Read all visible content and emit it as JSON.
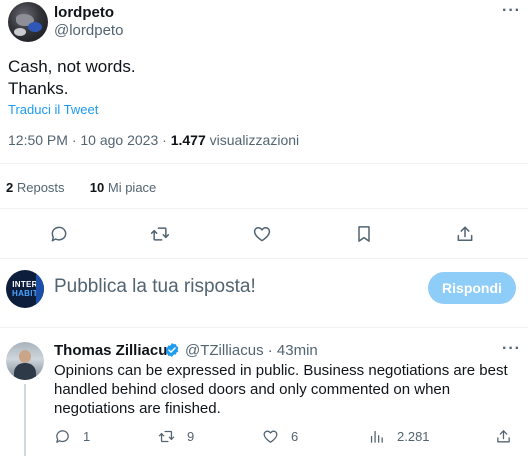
{
  "tweet": {
    "display_name": "lordpeto",
    "handle": "@lordpeto",
    "more": "···",
    "text_line1": "Cash, not words.",
    "text_line2": "Thanks.",
    "translate": "Traduci il Tweet",
    "time": "12:50 PM",
    "sep": " · ",
    "date": "10 ago 2023",
    "views_count": "1.477",
    "views_label": " visualizzazioni",
    "reposts_count": "2",
    "reposts_label": " Reposts",
    "likes_count": "10",
    "likes_label": " Mi piace"
  },
  "composer": {
    "avatar_line1": "INTER",
    "avatar_line2": "HABIT",
    "placeholder": "Pubblica la tua risposta!",
    "reply_button": "Rispondi"
  },
  "reply": {
    "display_name": "Thomas Zilliacus",
    "handle": "@TZilliacus · 43min",
    "more": "···",
    "text": "Opinions can be expressed in public. Business negotiations are best handled behind closed doors and only commented on when negotiations are finished.",
    "replies": "1",
    "reposts": "9",
    "likes": "6",
    "views": "2.281"
  },
  "colors": {
    "accent": "#1d9bf0",
    "reply_button_bg": "#8ecdf8",
    "muted": "#536471"
  },
  "icons": [
    "reply-icon",
    "repost-icon",
    "like-icon",
    "bookmark-icon",
    "share-icon",
    "verified-icon",
    "views-icon",
    "more-icon"
  ]
}
